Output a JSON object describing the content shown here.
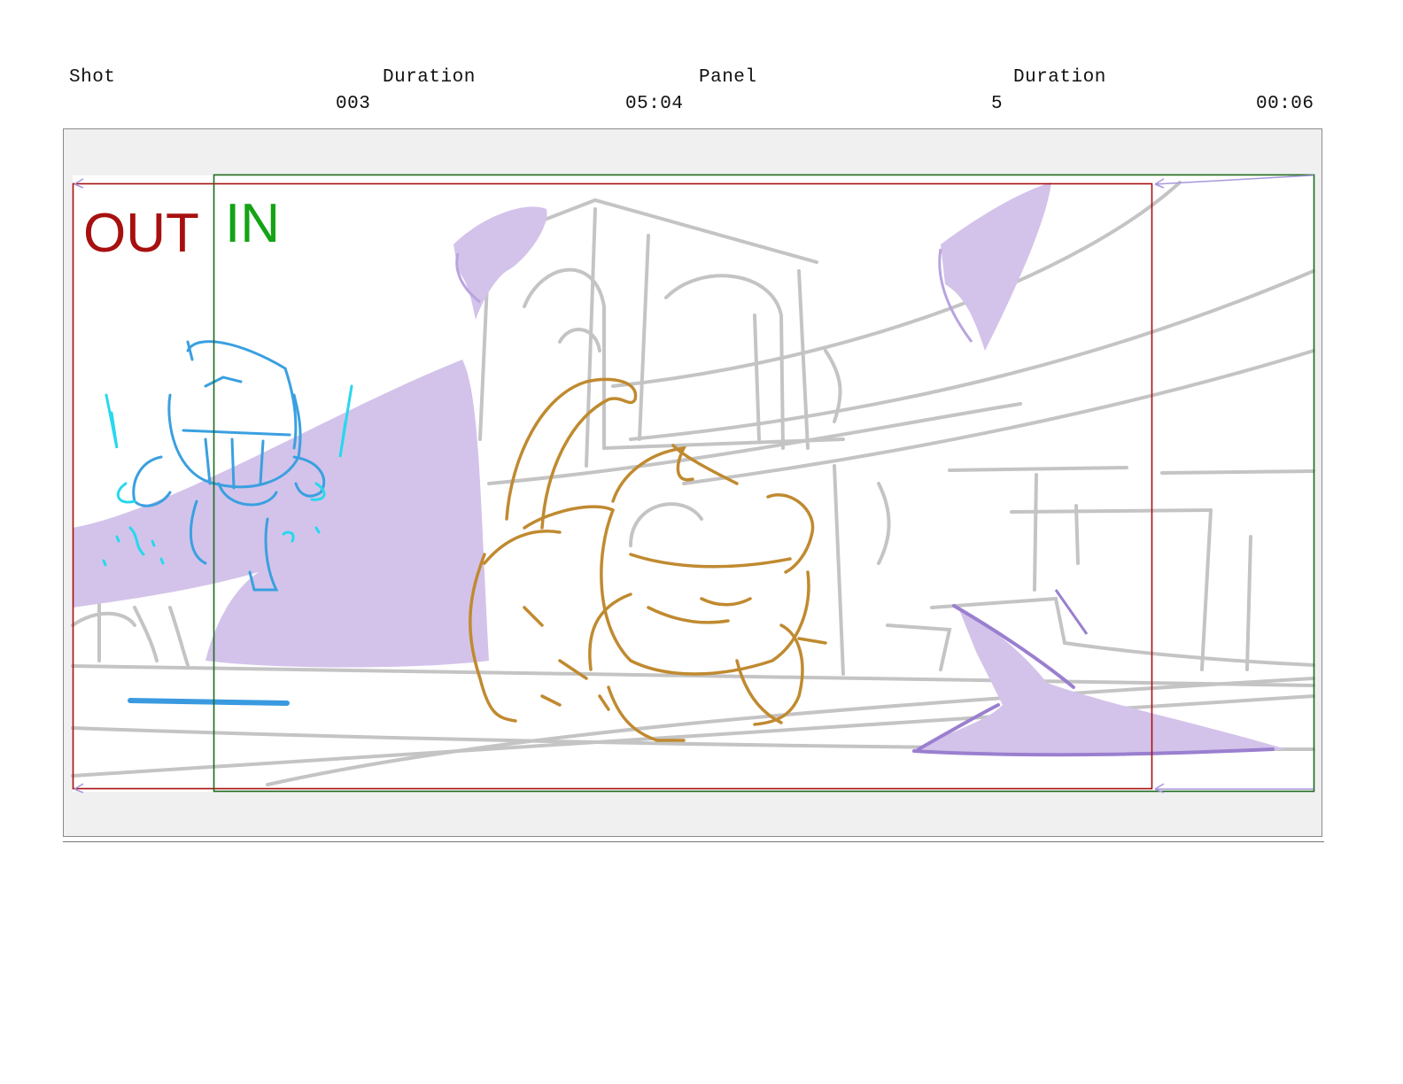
{
  "header": {
    "shot_label": "Shot",
    "shot_duration_label": "Duration",
    "panel_label": "Panel",
    "panel_duration_label": "Duration",
    "shot_value": "003",
    "shot_duration_value": "05:04",
    "panel_value": "5",
    "panel_duration_value": "00:06"
  },
  "frames": {
    "out_label": "OUT",
    "in_label": "IN",
    "out_color": "#a81010",
    "in_color": "#13a313"
  },
  "colors": {
    "sketch_gray": "#c4c4c4",
    "wing_purple": "#d3c3ea",
    "line_purple": "#9a7fcf",
    "robot_blue": "#3aa0e0",
    "glow_cyan": "#27d8ee",
    "cat_gold": "#c08a30"
  }
}
